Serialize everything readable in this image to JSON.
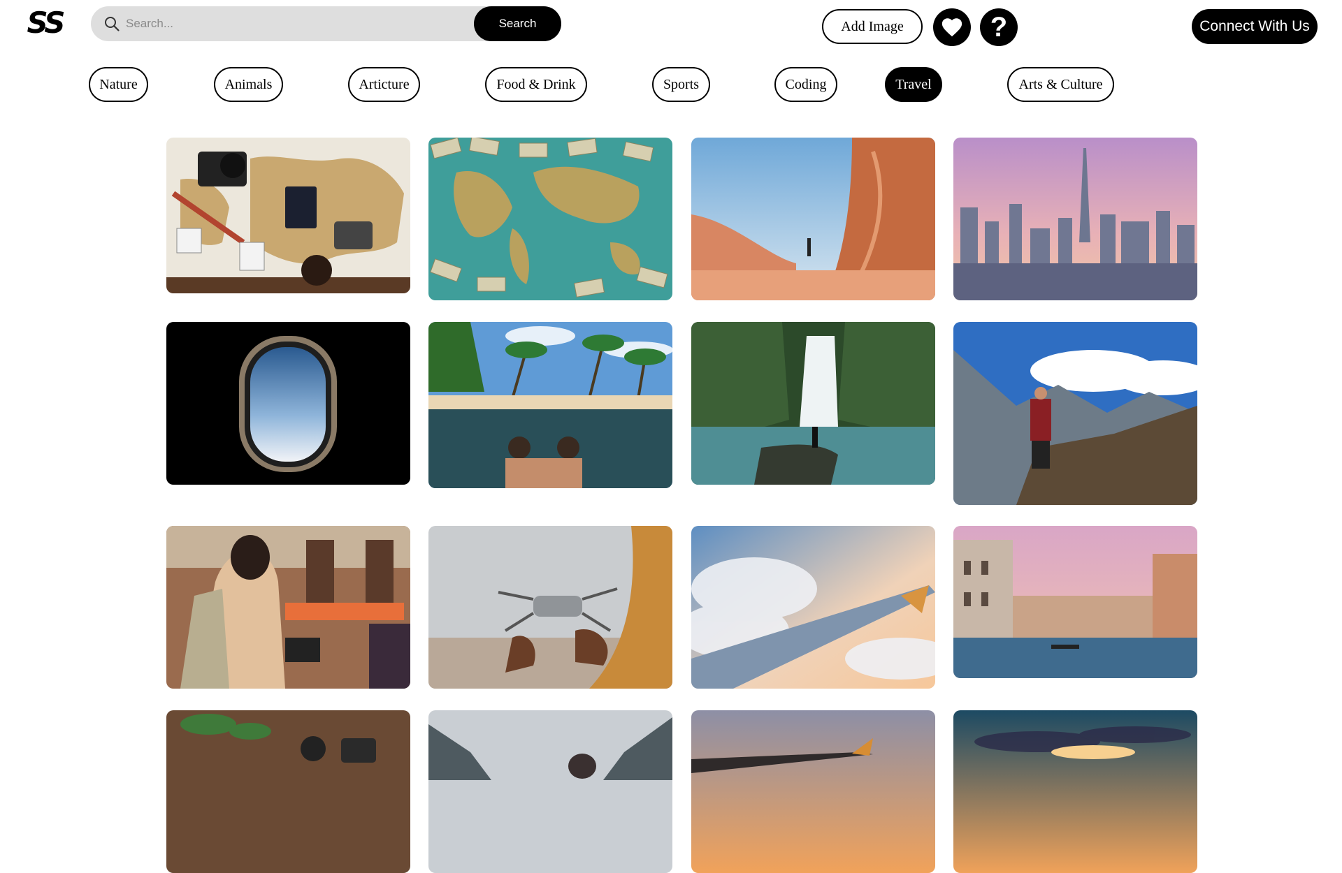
{
  "logo": {
    "text": "SS"
  },
  "search": {
    "placeholder": "Search...",
    "button_label": "Search"
  },
  "header": {
    "add_image_label": "Add Image",
    "favorites_icon": "heart-icon",
    "help_icon": "question-icon",
    "help_glyph": "?",
    "connect_label": "Connect With Us"
  },
  "categories": {
    "items": [
      {
        "label": "Nature"
      },
      {
        "label": "Animals"
      },
      {
        "label": "Articture"
      },
      {
        "label": "Food & Drink"
      },
      {
        "label": "Sports"
      },
      {
        "label": "Coding"
      },
      {
        "label": "Travel",
        "active": true
      },
      {
        "label": "Arts & Culture"
      }
    ]
  },
  "gallery": {
    "images": [
      {
        "subject": "world map with camera, passport and photos"
      },
      {
        "subject": "world map covered with banknotes"
      },
      {
        "subject": "red sandstone canyon with hiker"
      },
      {
        "subject": "city skyline with tall tower at sunset"
      },
      {
        "subject": "airplane window above clouds"
      },
      {
        "subject": "two people in resort pool with palm trees"
      },
      {
        "subject": "waterfall in jungle with person"
      },
      {
        "subject": "hiker on mountain ridge"
      },
      {
        "subject": "woman holding camera on street"
      },
      {
        "subject": "hands holding a drone at beach"
      },
      {
        "subject": "airplane wing above clouds"
      },
      {
        "subject": "venice canal with buildings"
      },
      {
        "subject": "wooden table with plants and camera"
      },
      {
        "subject": "mountain valley with person"
      },
      {
        "subject": "airplane wing at sunset"
      },
      {
        "subject": "colorful sunset sky"
      }
    ]
  },
  "colors": {
    "accent": "#000000",
    "search_bg": "#dedede",
    "background": "#ffffff"
  }
}
